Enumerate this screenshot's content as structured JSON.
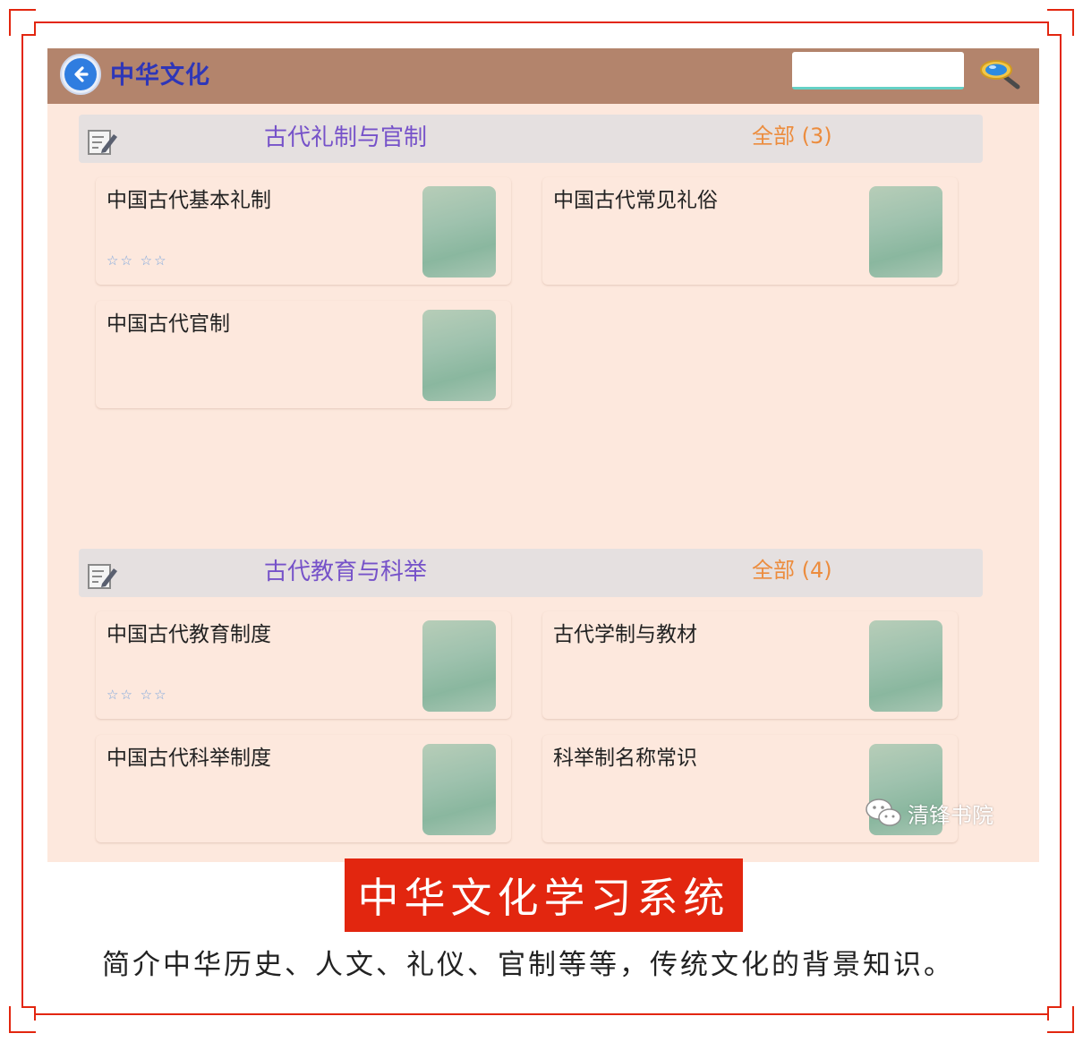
{
  "app": {
    "title": "中华文化",
    "search": {
      "value": "",
      "placeholder": ""
    }
  },
  "sections": [
    {
      "title": "古代礼制与官制",
      "all_label": "全部 (3)",
      "cards": [
        {
          "title": "中国古代基本礼制",
          "rating": "☆☆ ☆☆"
        },
        {
          "title": "中国古代常见礼俗",
          "rating": ""
        },
        {
          "title": "中国古代官制",
          "rating": ""
        }
      ]
    },
    {
      "title": "古代教育与科举",
      "all_label": "全部 (4)",
      "cards": [
        {
          "title": "中国古代教育制度",
          "rating": "☆☆ ☆☆"
        },
        {
          "title": "古代学制与教材",
          "rating": ""
        },
        {
          "title": "中国古代科举制度",
          "rating": ""
        },
        {
          "title": "科举制名称常识",
          "rating": ""
        }
      ]
    }
  ],
  "watermark": {
    "text": "清锋书院",
    "icon": "wechat-icon"
  },
  "caption": {
    "title": "中华文化学习系统",
    "description": "简介中华历史、人文、礼仪、官制等等，传统文化的背景知识。"
  },
  "colors": {
    "frame": "#e2260f",
    "topbar": "#b3846c",
    "app_background": "#fde8dd",
    "section_title": "#7652c9",
    "section_all": "#ec8c3d",
    "caption_background": "#e2260f"
  }
}
